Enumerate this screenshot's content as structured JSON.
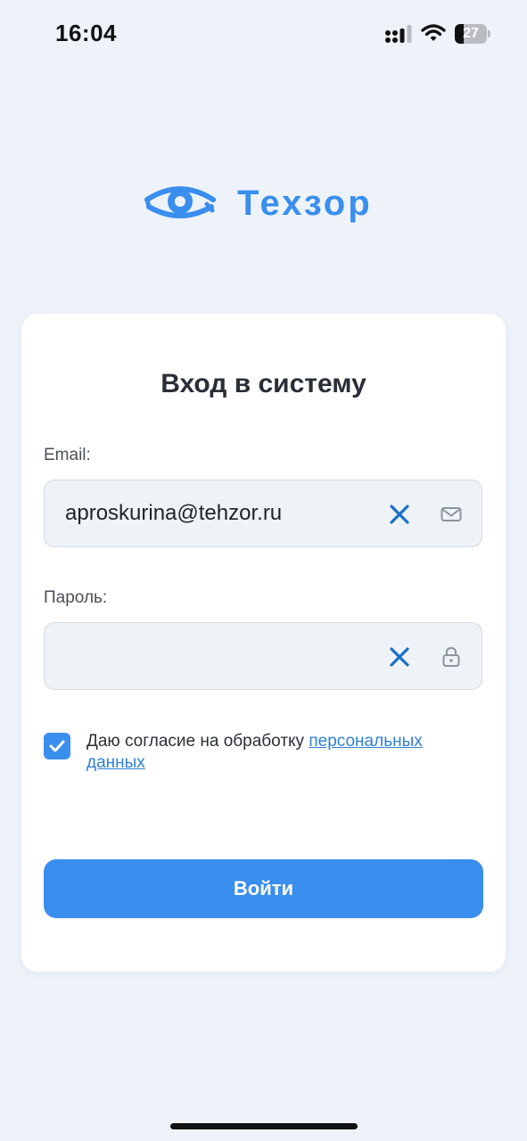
{
  "status_bar": {
    "time": "16:04",
    "battery_level": "27",
    "battery_fraction": 0.27
  },
  "logo": {
    "text": "Техзор",
    "icon": "eye-icon"
  },
  "login": {
    "title": "Вход в систему",
    "email_label": "Email:",
    "email_value": "aproskurina@tehzor.ru",
    "email_icon": "mail-icon",
    "password_label": "Пароль:",
    "password_value": "",
    "password_icon": "lock-icon",
    "clear_icon": "close-icon",
    "consent_checked": true,
    "consent_text": "Даю согласие на обработку ",
    "consent_link": "персональных данных",
    "submit_label": "Войти"
  },
  "colors": {
    "background": "#EDF3F9",
    "accent": "#3A8EEE",
    "link": "#2F80D6",
    "clear_icon": "#1A6FC9",
    "field_bg": "#EEF3F8",
    "card_bg": "#FFFFFF"
  }
}
